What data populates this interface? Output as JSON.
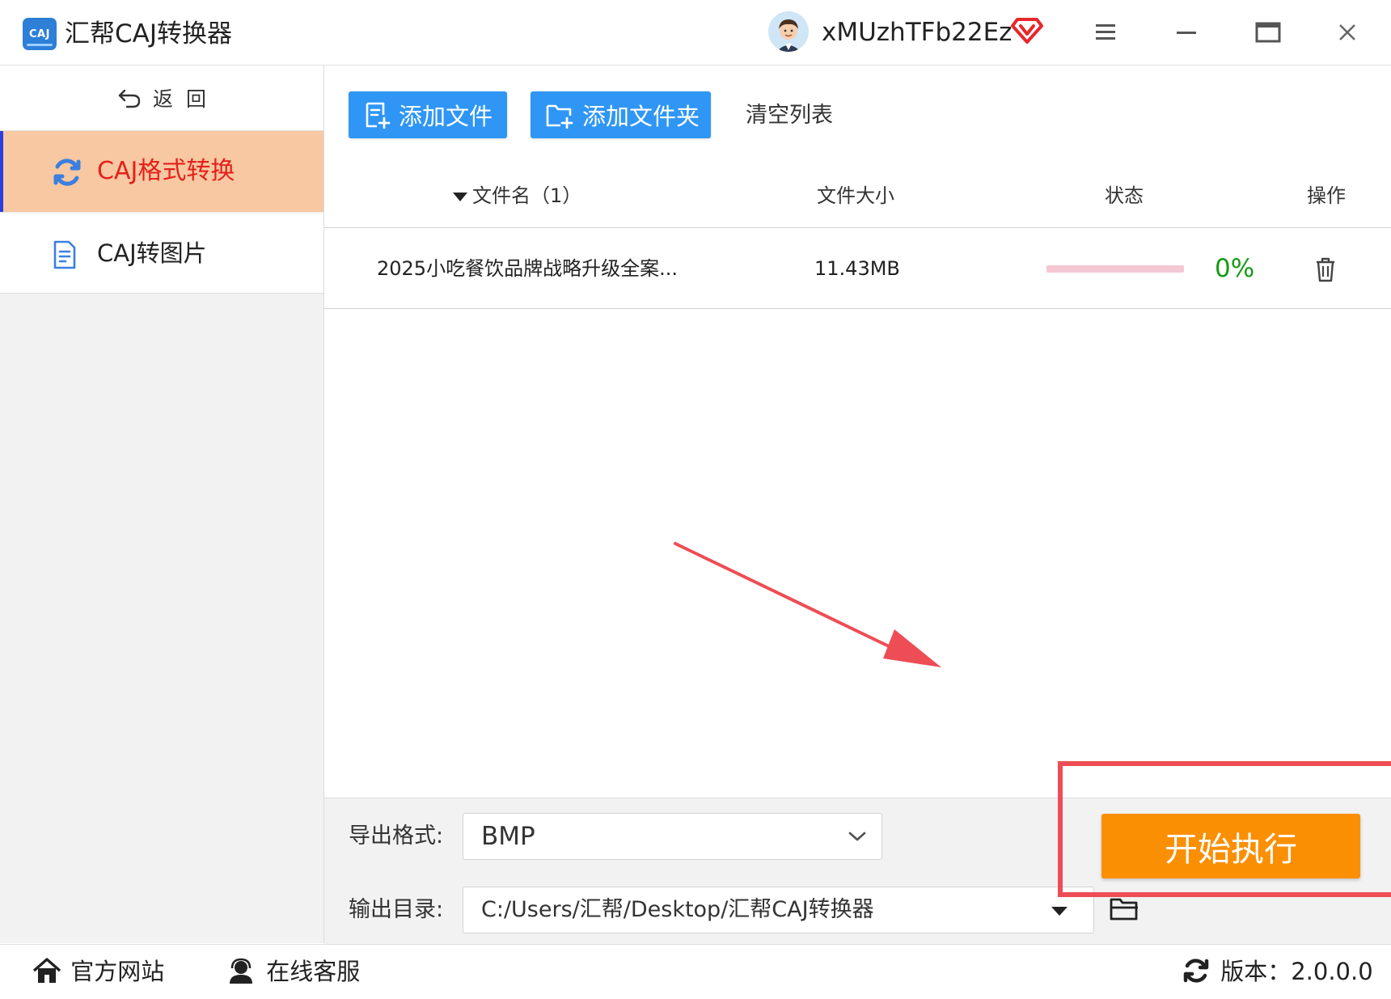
{
  "app": {
    "title": "汇帮CAJ转换器",
    "logo_text": "CAJ",
    "username": "xMUzhTFb22Ez"
  },
  "sidebar": {
    "back_label": "返  回",
    "items": [
      {
        "label": "CAJ格式转换",
        "icon": "refresh-icon",
        "active": true
      },
      {
        "label": "CAJ转图片",
        "icon": "document-icon",
        "active": false
      }
    ]
  },
  "toolbar": {
    "add_file": "添加文件",
    "add_folder": "添加文件夹",
    "clear_list": "清空列表"
  },
  "table": {
    "headers": {
      "name": "文件名（1）",
      "size": "文件大小",
      "status": "状态",
      "action": "操作"
    },
    "rows": [
      {
        "name": "2025小吃餐饮品牌战略升级全案...",
        "size": "11.43MB",
        "progress_percent": 0,
        "progress_label": "0%"
      }
    ]
  },
  "settings": {
    "format_label": "导出格式:",
    "format_value": "BMP",
    "output_label": "输出目录:",
    "output_value": "C:/Users/汇帮/Desktop/汇帮CAJ转换器",
    "start_label": "开始执行"
  },
  "footer": {
    "website": "官方网站",
    "support": "在线客服",
    "version": "版本：2.0.0.0"
  },
  "colors": {
    "accent_blue": "#2f96f5",
    "start_orange": "#fb8f04",
    "active_nav_bg": "#f7c8a1",
    "active_nav_text": "#e5201c",
    "progress_pink": "#f4c7d3",
    "percent_green": "#159a15",
    "annotation_red": "#ee4d55"
  }
}
